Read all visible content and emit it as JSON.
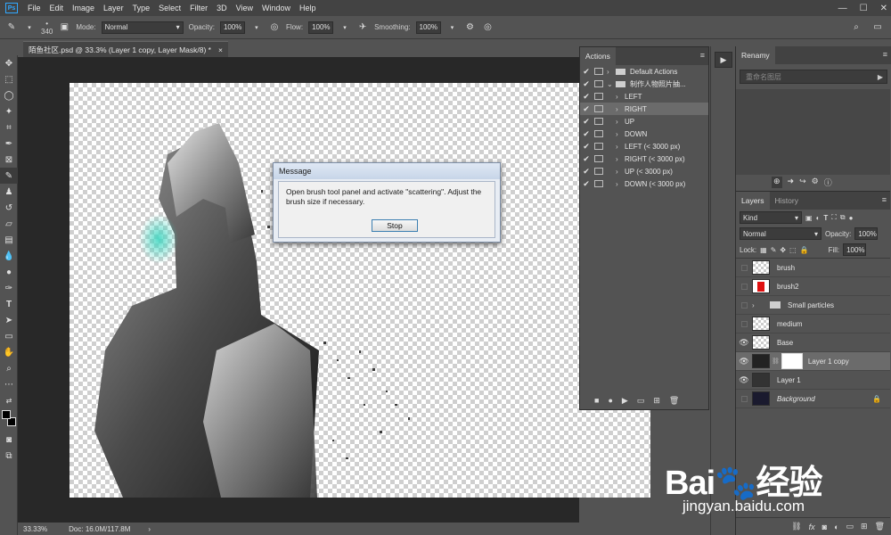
{
  "menu": {
    "items": [
      "File",
      "Edit",
      "Image",
      "Layer",
      "Type",
      "Select",
      "Filter",
      "3D",
      "View",
      "Window",
      "Help"
    ]
  },
  "options": {
    "brush_size": "340",
    "mode_label": "Mode:",
    "mode_value": "Normal",
    "opacity_label": "Opacity:",
    "opacity_value": "100%",
    "flow_label": "Flow:",
    "flow_value": "100%",
    "smoothing_label": "Smoothing:",
    "smoothing_value": "100%"
  },
  "document": {
    "tab_title": "陌鱼社区.psd @ 33.3% (Layer 1 copy, Layer Mask/8) *",
    "close_glyph": "×"
  },
  "status": {
    "zoom": "33.33%",
    "doc": "Doc: 16.0M/117.8M",
    "arrow": "›"
  },
  "dialog": {
    "title": "Message",
    "message": "Open brush tool panel and activate \"scattering\". Adjust the brush size if necessary.",
    "stop_label": "Stop"
  },
  "actions_panel": {
    "tab": "Actions",
    "rows": [
      {
        "label": "Default Actions",
        "folder": true,
        "expanded": false,
        "selected": false
      },
      {
        "label": "制作人物照片抽...",
        "folder": true,
        "expanded": true,
        "selected": false
      },
      {
        "label": "LEFT",
        "folder": false,
        "selected": false
      },
      {
        "label": "RIGHT",
        "folder": false,
        "selected": true
      },
      {
        "label": "UP",
        "folder": false,
        "selected": false
      },
      {
        "label": "DOWN",
        "folder": false,
        "selected": false
      },
      {
        "label": "LEFT (< 3000 px)",
        "folder": false,
        "selected": false
      },
      {
        "label": "RIGHT (< 3000 px)",
        "folder": false,
        "selected": false
      },
      {
        "label": "UP (< 3000 px)",
        "folder": false,
        "selected": false
      },
      {
        "label": "DOWN (< 3000 px)",
        "folder": false,
        "selected": false
      }
    ]
  },
  "renamy_panel": {
    "tab": "Renamy",
    "placeholder": "重命名图层"
  },
  "layers_panel": {
    "tabs": [
      "Layers",
      "History"
    ],
    "kind_label": "Kind",
    "blend_mode": "Normal",
    "opacity_label": "Opacity:",
    "opacity_value": "100%",
    "lock_label": "Lock:",
    "fill_label": "Fill:",
    "fill_value": "100%",
    "layers": [
      {
        "name": "brush",
        "visible": false,
        "selected": false,
        "type": "layer"
      },
      {
        "name": "brush2",
        "visible": false,
        "selected": false,
        "type": "layer"
      },
      {
        "name": "Small particles",
        "visible": false,
        "selected": false,
        "type": "group"
      },
      {
        "name": "medium",
        "visible": false,
        "selected": false,
        "type": "layer"
      },
      {
        "name": "Base",
        "visible": true,
        "selected": false,
        "type": "layer"
      },
      {
        "name": "Layer 1 copy",
        "visible": true,
        "selected": true,
        "type": "masked"
      },
      {
        "name": "Layer 1",
        "visible": true,
        "selected": false,
        "type": "layer"
      },
      {
        "name": "Background",
        "visible": false,
        "selected": false,
        "type": "background"
      }
    ]
  },
  "watermark": {
    "logo": "Bai🐾经验",
    "url": "jingyan.baidu.com"
  },
  "colors": {
    "accent": "#31a8ff",
    "panel": "#535353",
    "dark": "#424242",
    "selected": "#6b6b6b"
  }
}
